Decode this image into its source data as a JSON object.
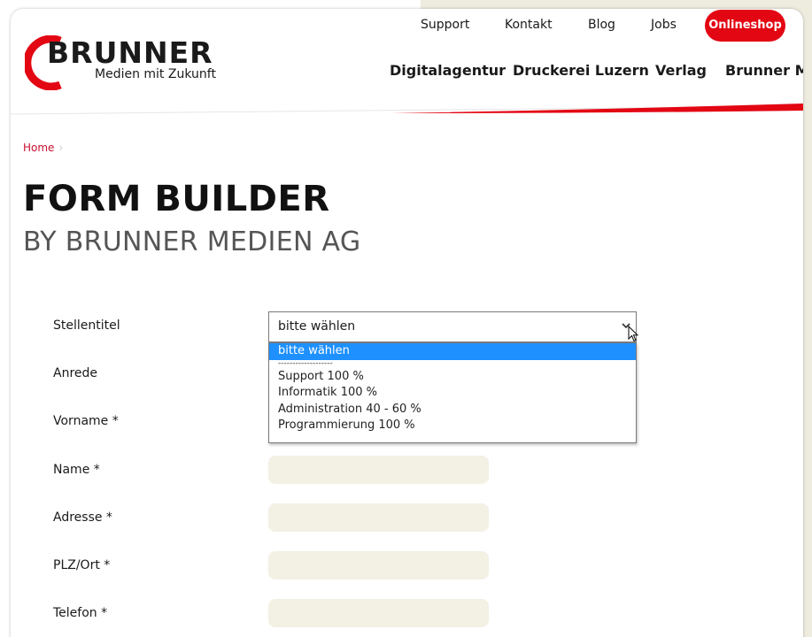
{
  "header": {
    "logo": {
      "name": "BRUNNER",
      "tagline": "Medien mit Zukunft"
    },
    "top_nav": [
      "Support",
      "Kontakt",
      "Blog",
      "Jobs"
    ],
    "shop_button": "Onlineshop",
    "main_nav": [
      "Digitalagentur",
      "Druckerei Luzern",
      "Verlag",
      "Brunner Me"
    ]
  },
  "breadcrumb": {
    "home": "Home",
    "separator": "›"
  },
  "page": {
    "title": "FORM BUILDER",
    "subtitle": "BY BRUNNER MEDIEN AG"
  },
  "form": {
    "stellentitel": {
      "label": "Stellentitel",
      "value": "bitte wählen",
      "options": [
        "bitte wählen",
        "-------------------",
        "Support 100 %",
        "Informatik 100 %",
        "Administration 40 - 60 %",
        "Programmierung 100 %"
      ],
      "selected_index": 0
    },
    "anrede_label": "Anrede",
    "vorname_label": "Vorname *",
    "name_label": "Name *",
    "adresse_label": "Adresse *",
    "plz_label": "PLZ/Ort *",
    "telefon_label": "Telefon *"
  },
  "colors": {
    "brand_red": "#e30613",
    "input_bg": "#f3f0e4",
    "page_bg": "#eeebdf",
    "selection": "#1e90ff"
  }
}
